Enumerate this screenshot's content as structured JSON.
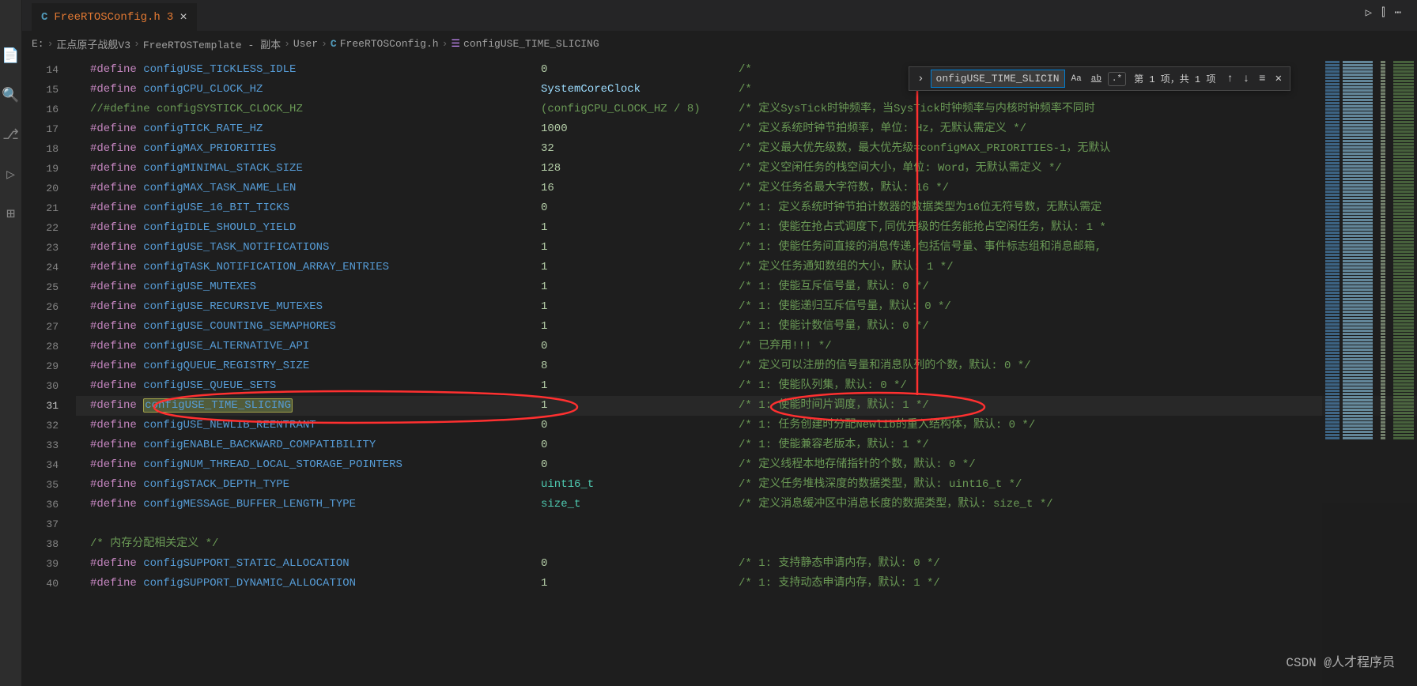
{
  "tab": {
    "lang": "C",
    "filename": "FreeRTOSConfig.h",
    "mod_count": "3",
    "close": "×"
  },
  "run_icons": {
    "play": "▷",
    "split": "⫿",
    "more": "⋯"
  },
  "breadcrumb": {
    "p0": "E:",
    "p1": "正点原子战舰V3",
    "p2": "FreeRTOSTemplate - 副本",
    "p3": "User",
    "lang": "C",
    "file": "FreeRTOSConfig.h",
    "sym_icon": "☰",
    "symbol": "configUSE_TIME_SLICING",
    "sep": "›"
  },
  "find": {
    "toggle": "›",
    "value": "onfigUSE_TIME_SLICING",
    "opt_case": "Aa",
    "opt_word": "ab",
    "opt_regex": ".*",
    "result": "第 1 项，共 1 项",
    "prev": "↑",
    "next": "↓",
    "sel": "≡",
    "close": "✕"
  },
  "lines": [
    {
      "n": 14,
      "define": "#define",
      "name": "configUSE_TICKLESS_IDLE",
      "val": "0",
      "comment": "/*"
    },
    {
      "n": 15,
      "define": "#define",
      "name": "configCPU_CLOCK_HZ",
      "valIdent": "SystemCoreClock",
      "comment": "/*"
    },
    {
      "n": 16,
      "defineComment": "//#define configSYSTICK_CLOCK_HZ",
      "valComment": "(configCPU_CLOCK_HZ / 8)",
      "comment": "/* 定义SysTick时钟频率，当SysTick时钟频率与内核时钟频率不同时"
    },
    {
      "n": 17,
      "define": "#define",
      "name": "configTICK_RATE_HZ",
      "val": "1000",
      "comment": "/* 定义系统时钟节拍频率，单位: Hz，无默认需定义 */"
    },
    {
      "n": 18,
      "define": "#define",
      "name": "configMAX_PRIORITIES",
      "val": "32",
      "comment": "/* 定义最大优先级数，最大优先级=configMAX_PRIORITIES-1，无默认"
    },
    {
      "n": 19,
      "define": "#define",
      "name": "configMINIMAL_STACK_SIZE",
      "val": "128",
      "comment": "/* 定义空闲任务的栈空间大小，单位: Word，无默认需定义 */"
    },
    {
      "n": 20,
      "define": "#define",
      "name": "configMAX_TASK_NAME_LEN",
      "val": "16",
      "comment": "/* 定义任务名最大字符数，默认: 16 */"
    },
    {
      "n": 21,
      "define": "#define",
      "name": "configUSE_16_BIT_TICKS",
      "val": "0",
      "comment": "/* 1: 定义系统时钟节拍计数器的数据类型为16位无符号数，无默认需定"
    },
    {
      "n": 22,
      "define": "#define",
      "name": "configIDLE_SHOULD_YIELD",
      "val": "1",
      "comment": "/* 1: 使能在抢占式调度下,同优先级的任务能抢占空闲任务，默认: 1 *"
    },
    {
      "n": 23,
      "define": "#define",
      "name": "configUSE_TASK_NOTIFICATIONS",
      "val": "1",
      "comment": "/* 1: 使能任务间直接的消息传递,包括信号量、事件标志组和消息邮箱,"
    },
    {
      "n": 24,
      "define": "#define",
      "name": "configTASK_NOTIFICATION_ARRAY_ENTRIES",
      "val": "1",
      "comment": "/* 定义任务通知数组的大小，默认: 1 */"
    },
    {
      "n": 25,
      "define": "#define",
      "name": "configUSE_MUTEXES",
      "val": "1",
      "comment": "/* 1: 使能互斥信号量，默认: 0 */"
    },
    {
      "n": 26,
      "define": "#define",
      "name": "configUSE_RECURSIVE_MUTEXES",
      "val": "1",
      "comment": "/* 1: 使能递归互斥信号量，默认: 0 */"
    },
    {
      "n": 27,
      "define": "#define",
      "name": "configUSE_COUNTING_SEMAPHORES",
      "val": "1",
      "comment": "/* 1: 使能计数信号量，默认: 0 */"
    },
    {
      "n": 28,
      "define": "#define",
      "name": "configUSE_ALTERNATIVE_API",
      "val": "0",
      "comment": "/* 已弃用!!! */"
    },
    {
      "n": 29,
      "define": "#define",
      "name": "configQUEUE_REGISTRY_SIZE",
      "val": "8",
      "comment": "/* 定义可以注册的信号量和消息队列的个数，默认: 0 */"
    },
    {
      "n": 30,
      "define": "#define",
      "name": "configUSE_QUEUE_SETS",
      "val": "1",
      "comment": "/* 1: 使能队列集，默认: 0 */"
    },
    {
      "n": 31,
      "define": "#define",
      "name": "configUSE_TIME_SLICING",
      "val": "1",
      "comment": "/* 1: 使能时间片调度，默认: 1 */",
      "current": true,
      "highlightName": true
    },
    {
      "n": 32,
      "define": "#define",
      "name": "configUSE_NEWLIB_REENTRANT",
      "val": "0",
      "comment": "/* 1: 任务创建时分配Newlib的重入结构体，默认: 0 */"
    },
    {
      "n": 33,
      "define": "#define",
      "name": "configENABLE_BACKWARD_COMPATIBILITY",
      "val": "0",
      "comment": "/* 1: 使能兼容老版本，默认: 1 */"
    },
    {
      "n": 34,
      "define": "#define",
      "name": "configNUM_THREAD_LOCAL_STORAGE_POINTERS",
      "val": "0",
      "comment": "/* 定义线程本地存储指针的个数，默认: 0 */"
    },
    {
      "n": 35,
      "define": "#define",
      "name": "configSTACK_DEPTH_TYPE",
      "valType": "uint16_t",
      "comment": "/* 定义任务堆栈深度的数据类型，默认: uint16_t */"
    },
    {
      "n": 36,
      "define": "#define",
      "name": "configMESSAGE_BUFFER_LENGTH_TYPE",
      "valType": "size_t",
      "comment": "/* 定义消息缓冲区中消息长度的数据类型，默认: size_t */"
    },
    {
      "n": 37,
      "blank": true
    },
    {
      "n": 38,
      "pureComment": "/* 内存分配相关定义 */"
    },
    {
      "n": 39,
      "define": "#define",
      "name": "configSUPPORT_STATIC_ALLOCATION",
      "val": "0",
      "comment": "/* 1: 支持静态申请内存，默认: 0 */"
    },
    {
      "n": 40,
      "define": "#define",
      "name": "configSUPPORT_DYNAMIC_ALLOCATION",
      "val": "1",
      "comment": "/* 1: 支持动态申请内存，默认: 1 */"
    }
  ],
  "watermark": "CSDN @人才程序员"
}
